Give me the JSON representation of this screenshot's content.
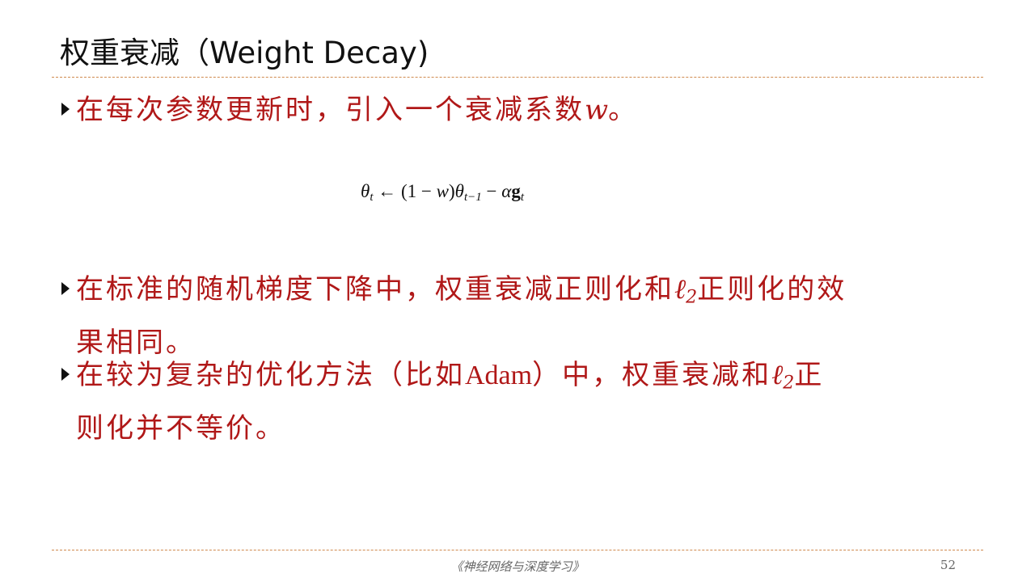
{
  "slide": {
    "title": "权重衰减（Weight Decay)"
  },
  "bullets": [
    {
      "text": "在每次参数更新时，引入一个衰减系数",
      "var": "w",
      "tail": "。"
    },
    {
      "text": "在标准的随机梯度下降中，权重衰减正则化和",
      "var": "ℓ",
      "sub": "2",
      "tail": "正则化的效",
      "line2": "果相同。"
    },
    {
      "text": "在较为复杂的优化方法（比如",
      "latin": "Adam",
      "text2": "）中，权重衰减和",
      "var": "ℓ",
      "sub": "2",
      "tail": "正",
      "line2": "则化并不等价。"
    }
  ],
  "formula": {
    "theta": "θ",
    "t": "t",
    "arrow": " ← (1 − ",
    "w": "w",
    "close": ")",
    "t_minus_1": "t−1",
    "minus": " − ",
    "alpha": "α",
    "g": "g"
  },
  "footer": {
    "book_title": "《神经网络与深度学习》",
    "page_number": "52"
  }
}
